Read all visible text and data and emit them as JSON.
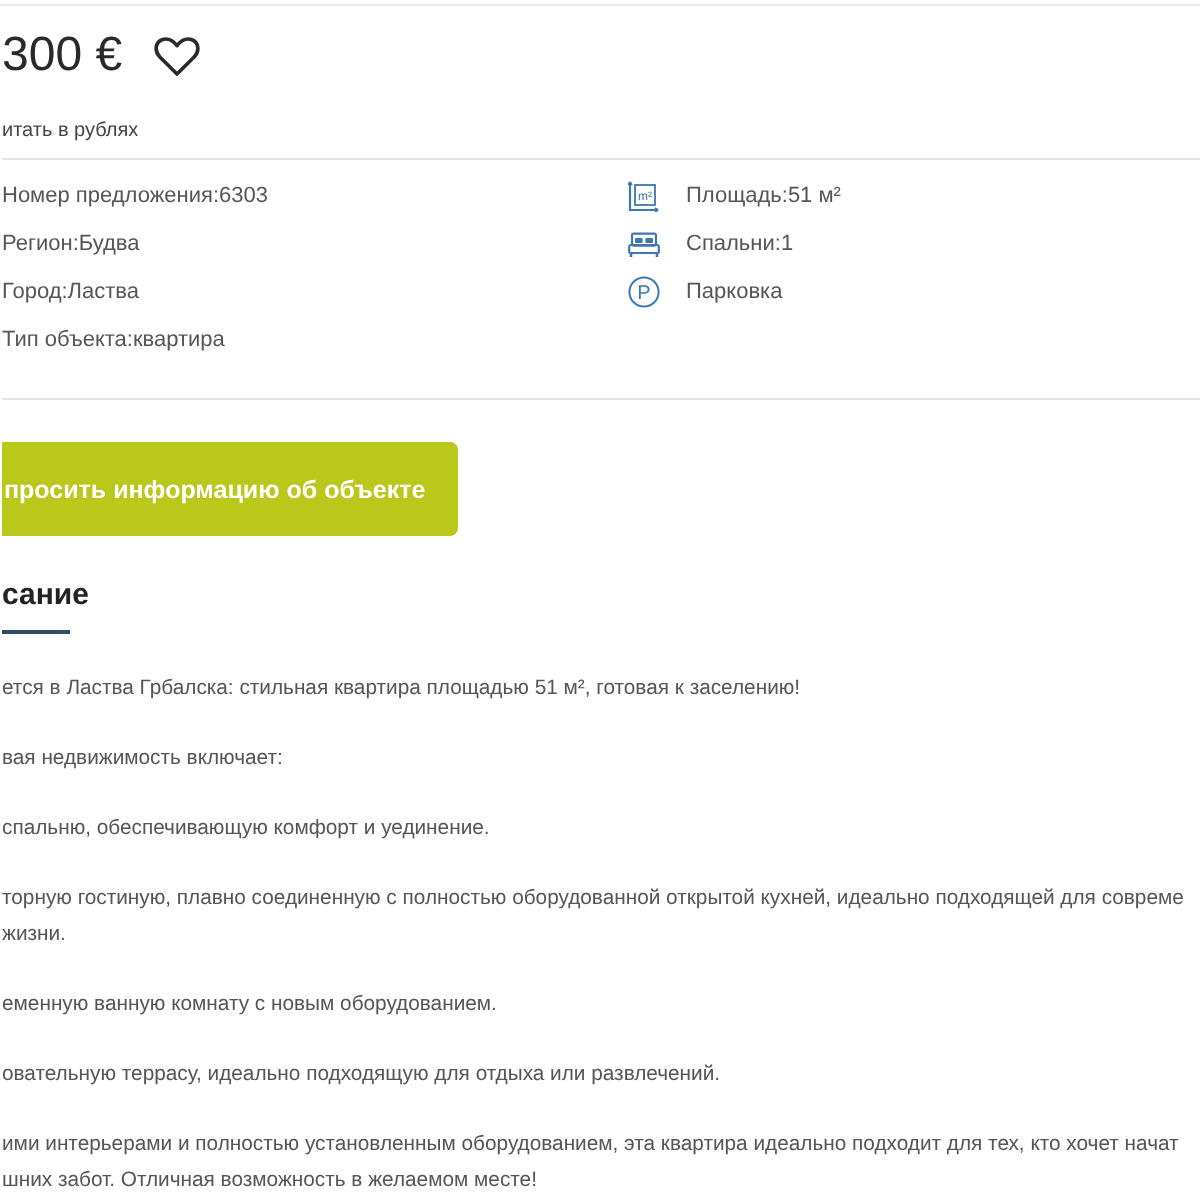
{
  "price": {
    "text": "300 €",
    "favorite": false
  },
  "currency_link": "итать в рублях",
  "details": [
    "Номер предложения:6303",
    "Регион:Будва",
    "Город:Ластва",
    "Тип объекта:квартира"
  ],
  "features": [
    {
      "kind": "area",
      "label": "Площадь:51 м²",
      "icon_text": "m²"
    },
    {
      "kind": "bedrooms",
      "label": "Спальни:1"
    },
    {
      "kind": "parking",
      "label": "Парковка",
      "icon_text": "P"
    }
  ],
  "request_button": "просить информацию об объекте",
  "description": {
    "heading": "сание",
    "paragraphs": [
      {
        "lines": [
          "ется в Ластва Грбалска: стильная квартира площадью 51 м², готовая к заселению!"
        ]
      },
      {
        "lines": [
          "вая недвижимость включает:"
        ]
      },
      {
        "lines": [
          "спальню, обеспечивающую комфорт и уединение."
        ]
      },
      {
        "lines": [
          "торную гостиную, плавно соединенную с полностью оборудованной открытой кухней, идеально подходящей для совреме",
          "жизни."
        ]
      },
      {
        "lines": [
          "еменную ванную комнату с новым оборудованием."
        ]
      },
      {
        "lines": [
          "овательную террасу, идеально подходящую для отдыха или развлечений."
        ]
      },
      {
        "lines": [
          "ими интерьерами и полностью установленным оборудованием, эта квартира идеально подходит для тех, кто хочет начат",
          "шних забот. Отличная возможность в желаемом месте!"
        ]
      }
    ]
  }
}
